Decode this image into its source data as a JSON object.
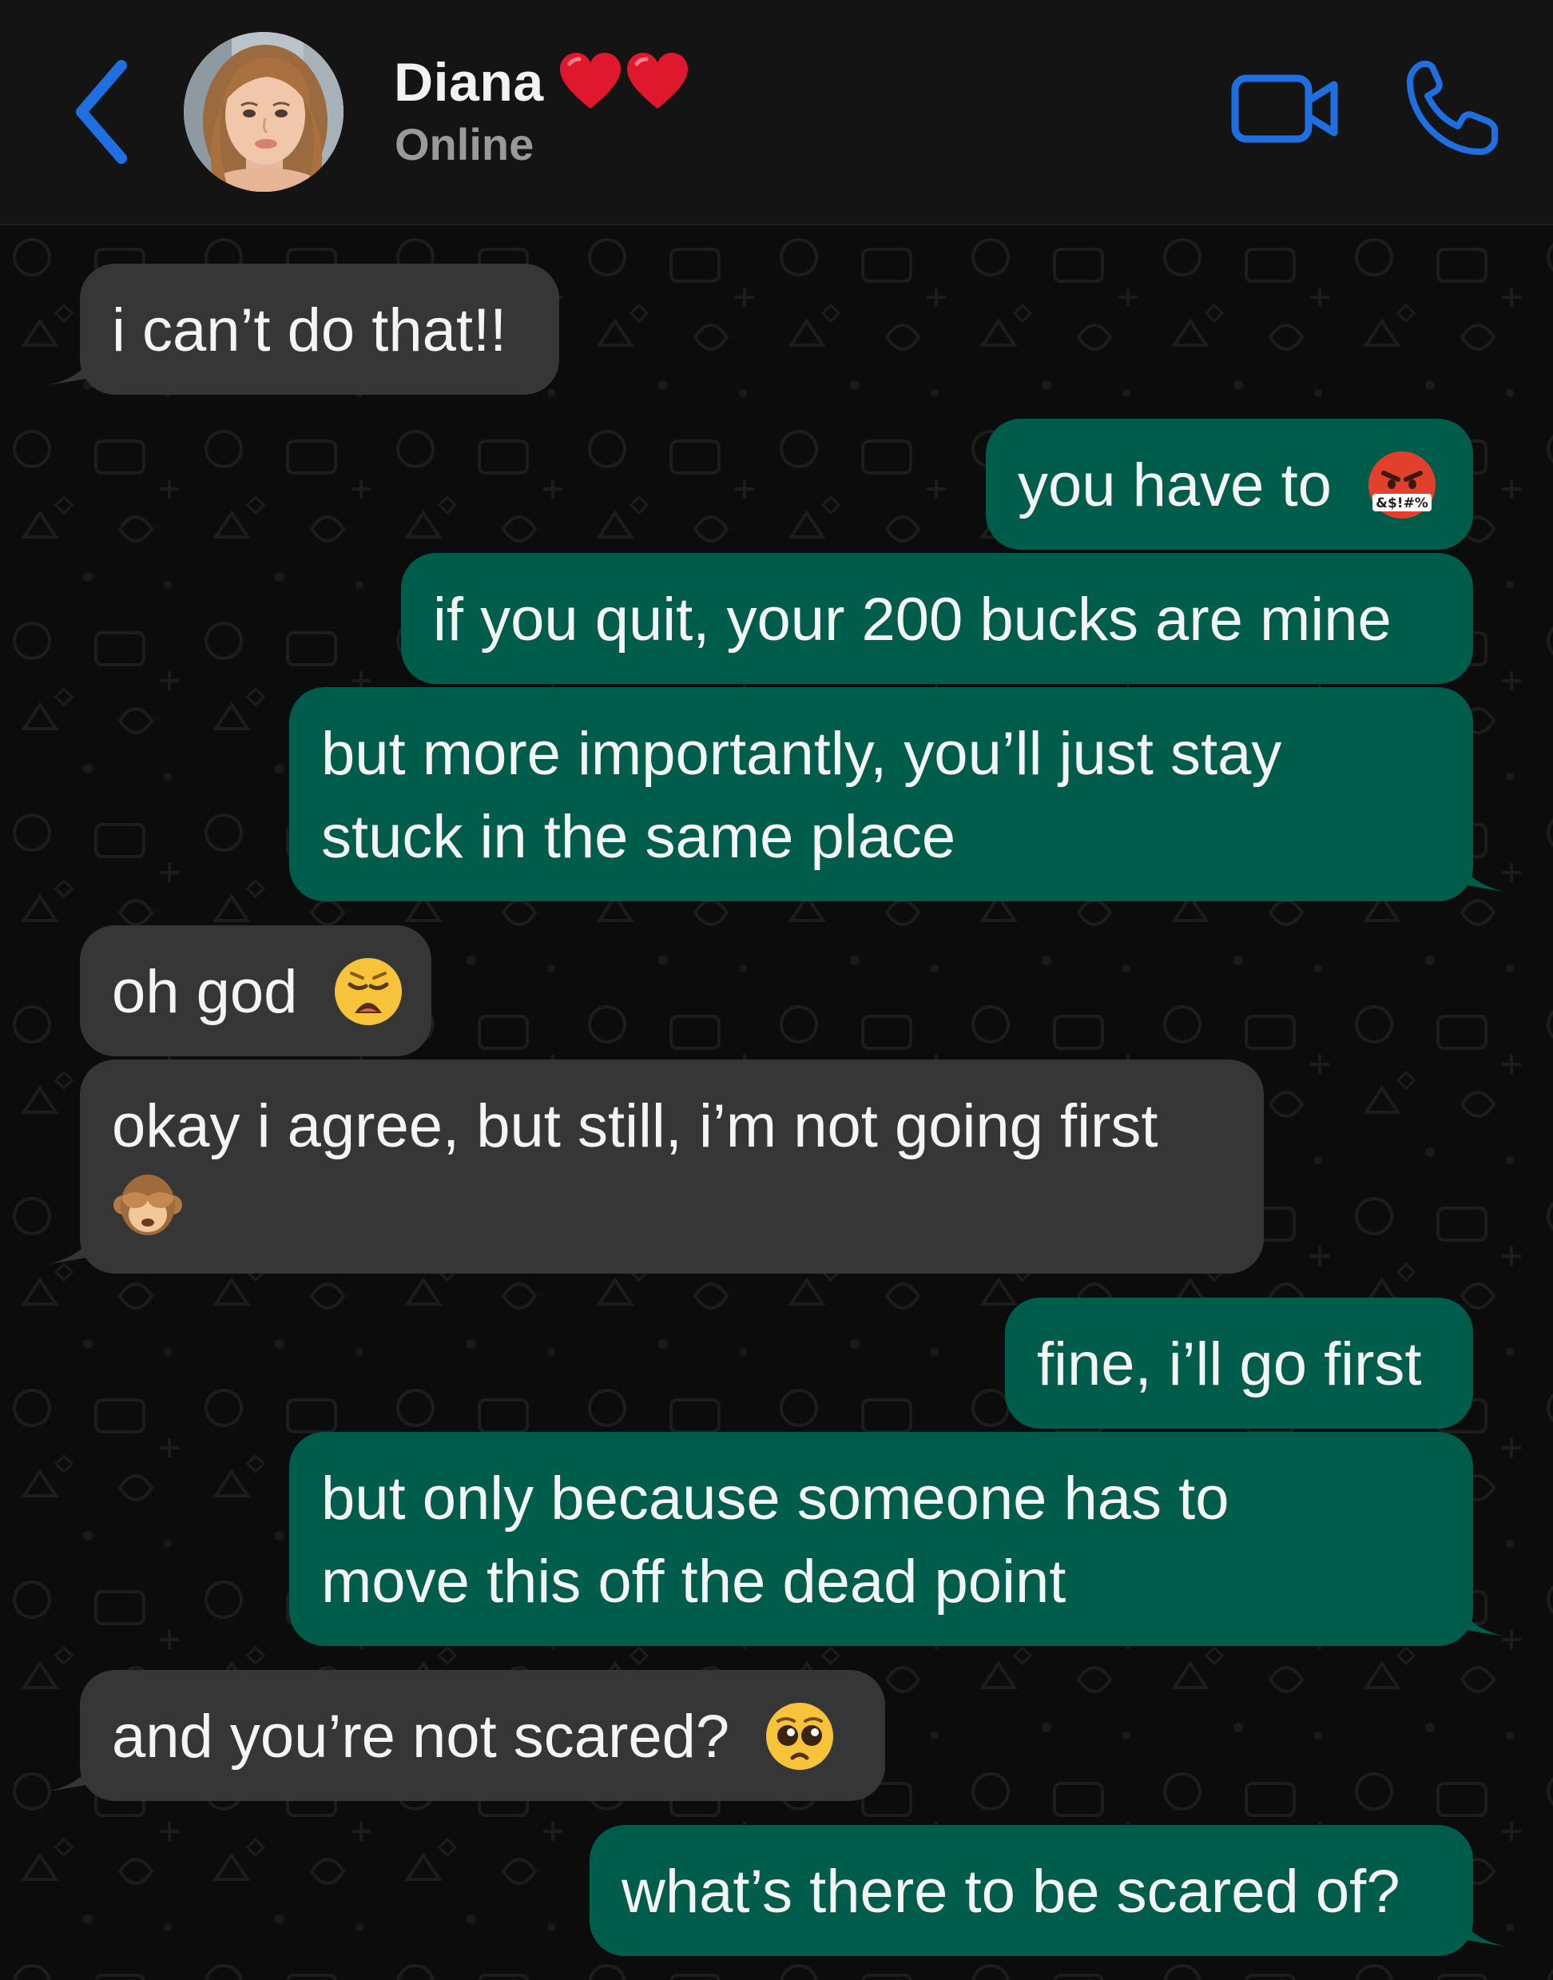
{
  "header": {
    "contact_name": "Diana",
    "status": "Online",
    "name_decoration": "two-red-hearts"
  },
  "colors": {
    "accent": "#1f6fe0",
    "incoming_bubble": "#363636",
    "outgoing_bubble": "#005c4b",
    "header_bg": "#141414",
    "chat_bg": "#0c0c0c",
    "status_text": "#9a9a9a"
  },
  "messages": [
    {
      "direction": "incoming",
      "line1": "i can’t do that!!",
      "line2": "",
      "emoji": ""
    },
    {
      "direction": "outgoing",
      "line1": "you have to",
      "line2": "",
      "emoji": "face-with-symbols-on-mouth"
    },
    {
      "direction": "outgoing",
      "line1": "if you quit, your 200 bucks are mine",
      "line2": "",
      "emoji": ""
    },
    {
      "direction": "outgoing",
      "line1": "but more importantly, you’ll just stay",
      "line2": "stuck in the same place",
      "emoji": ""
    },
    {
      "direction": "incoming",
      "line1": "oh god",
      "line2": "",
      "emoji": "weary-face"
    },
    {
      "direction": "incoming",
      "line1": "okay i agree, but still, i’m not going first",
      "line2": "",
      "emoji": "see-no-evil-monkey"
    },
    {
      "direction": "outgoing",
      "line1": "fine, i’ll go first",
      "line2": "",
      "emoji": ""
    },
    {
      "direction": "outgoing",
      "line1": "but only because someone has to",
      "line2": "move this off the dead point",
      "emoji": ""
    },
    {
      "direction": "incoming",
      "line1": "and you’re not scared?",
      "line2": "",
      "emoji": "pleading-face"
    },
    {
      "direction": "outgoing",
      "line1": "what’s there to be scared of?",
      "line2": "",
      "emoji": ""
    }
  ]
}
